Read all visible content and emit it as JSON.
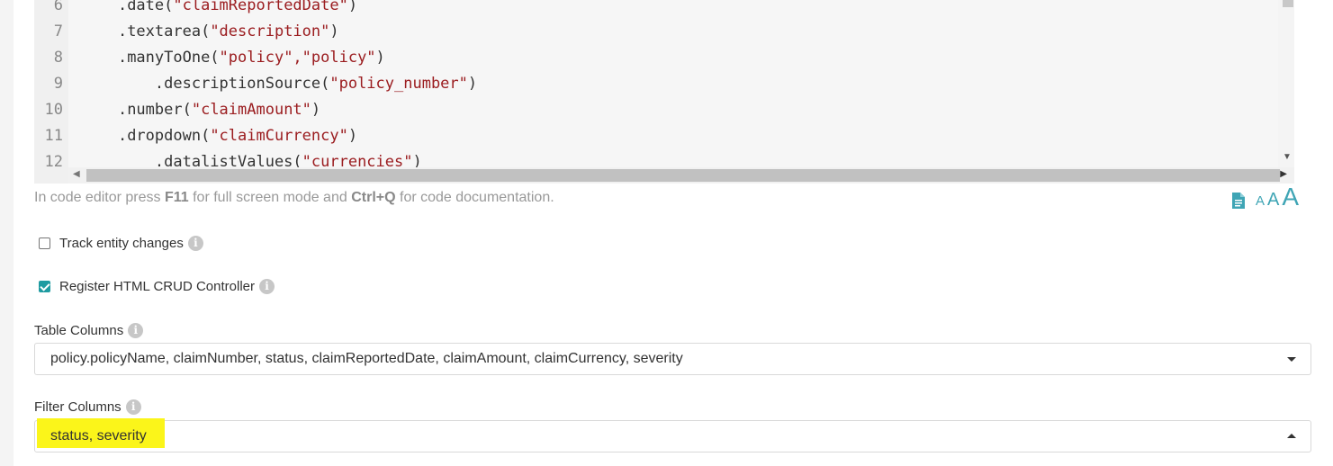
{
  "editor": {
    "line_numbers": [
      "6",
      "7",
      "8",
      "9",
      "10",
      "11",
      "12"
    ],
    "lines": [
      {
        "indent": "    ",
        "method": ".date(",
        "args": "\"claimReportedDate\"",
        "close": ")"
      },
      {
        "indent": "    ",
        "method": ".textarea(",
        "args": "\"description\"",
        "close": ")"
      },
      {
        "indent": "    ",
        "method": ".manyToOne(",
        "args": "\"policy\",\"policy\"",
        "close": ")"
      },
      {
        "indent": "        ",
        "method": ".descriptionSource(",
        "args": "\"policy_number\"",
        "close": ")"
      },
      {
        "indent": "    ",
        "method": ".number(",
        "args": "\"claimAmount\"",
        "close": ")"
      },
      {
        "indent": "    ",
        "method": ".dropdown(",
        "args": "\"claimCurrency\"",
        "close": ")"
      },
      {
        "indent": "        ",
        "method": ".datalistValues(",
        "args": "\"currencies\"",
        "close": ")"
      }
    ]
  },
  "hint": {
    "prefix": "In code editor press ",
    "key1": "F11",
    "middle": " for full screen mode and ",
    "key2": "Ctrl+Q",
    "suffix": " for code documentation."
  },
  "font_size_labels": [
    "A",
    "A",
    "A"
  ],
  "track_changes": {
    "label": "Track entity changes",
    "checked": false
  },
  "register_crud": {
    "label": "Register HTML CRUD Controller",
    "checked": true
  },
  "table_columns": {
    "label": "Table Columns",
    "value": "policy.policyName, claimNumber, status, claimReportedDate, claimAmount, claimCurrency, severity"
  },
  "filter_columns": {
    "label": "Filter Columns",
    "value": "status, severity"
  },
  "colors": {
    "accent": "#3fa5b5",
    "string": "#9b1d20",
    "highlight": "#fbf51a"
  }
}
